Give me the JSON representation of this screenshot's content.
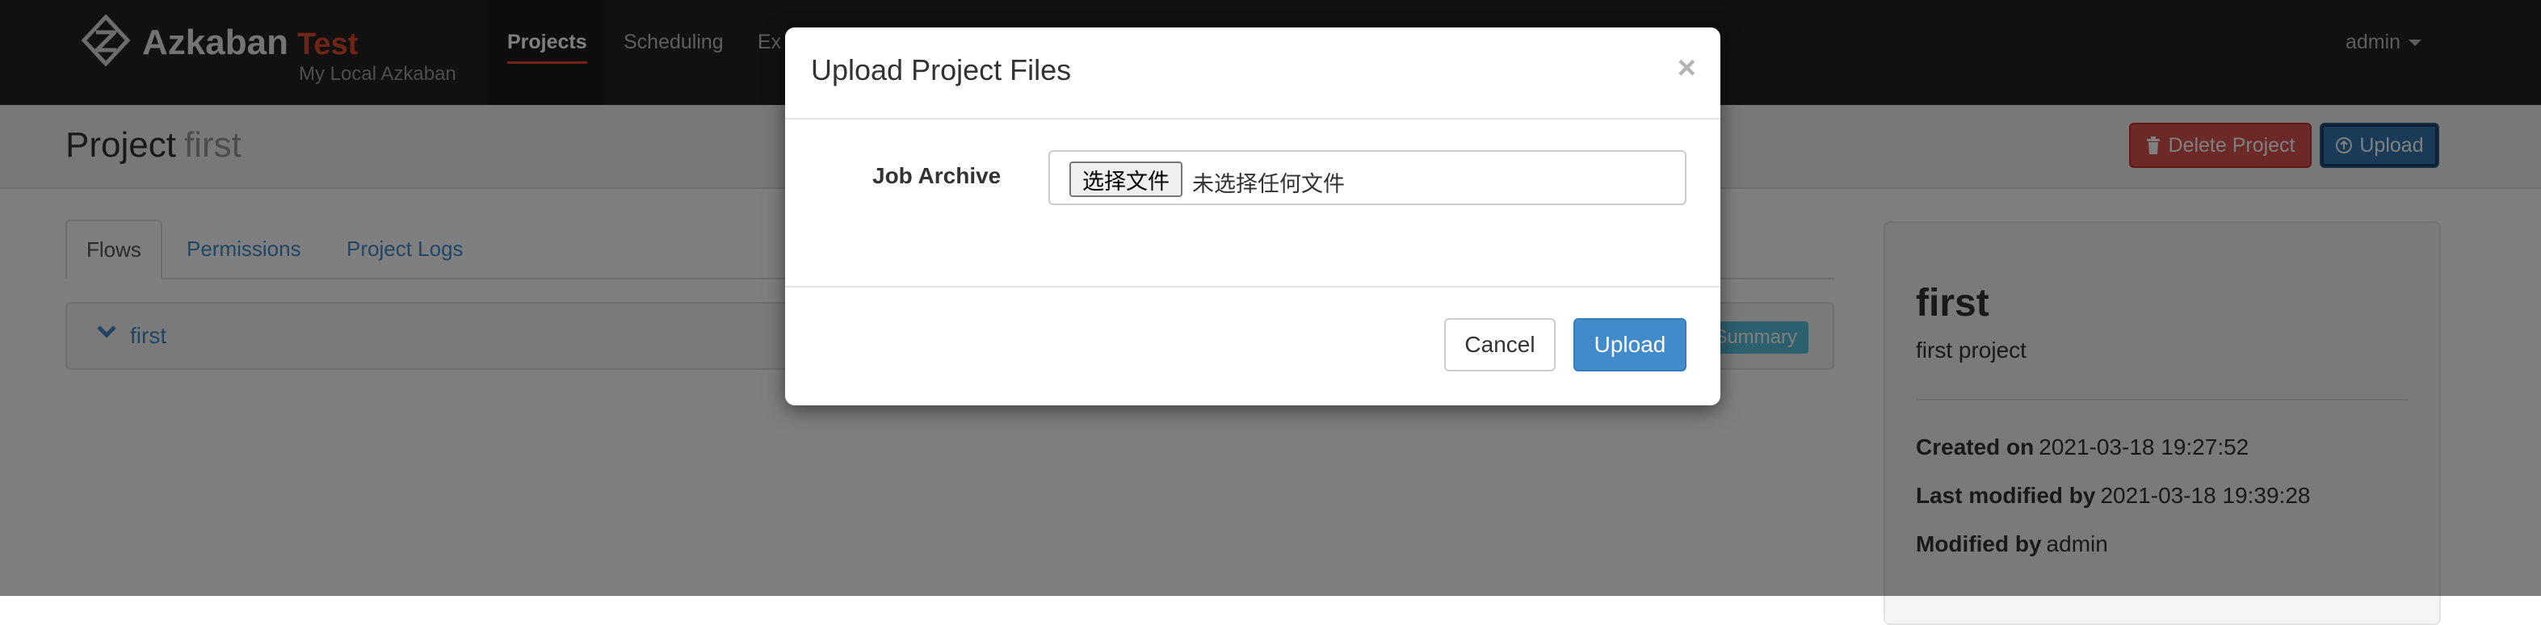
{
  "navbar": {
    "brand_name": "Azkaban",
    "brand_env": "Test",
    "brand_subtitle": "My Local Azkaban",
    "nav_items": [
      "Projects",
      "Scheduling",
      "Ex"
    ],
    "user": "admin"
  },
  "page_header": {
    "title_prefix": "Project",
    "project_name": "first",
    "delete_button": "Delete Project",
    "upload_button": "Upload"
  },
  "tabs": [
    "Flows",
    "Permissions",
    "Project Logs"
  ],
  "flow": {
    "name": "first",
    "summary_label": "Summary"
  },
  "sidebar": {
    "title": "first",
    "description": "first project",
    "created_label": "Created on",
    "created_value": "2021-03-18 19:27:52",
    "modified_label": "Last modified by",
    "modified_value": "2021-03-18 19:39:28",
    "modified_by_label": "Modified by",
    "modified_by_value": "admin"
  },
  "modal": {
    "title": "Upload Project Files",
    "close": "×",
    "field_label": "Job Archive",
    "file_button": "选择文件",
    "file_status": "未选择任何文件",
    "cancel_button": "Cancel",
    "upload_button": "Upload"
  },
  "colors": {
    "navbar": "#222222",
    "accent": "#e0492d",
    "primary": "#428bca",
    "danger": "#d9534f",
    "info": "#5bc0de"
  }
}
